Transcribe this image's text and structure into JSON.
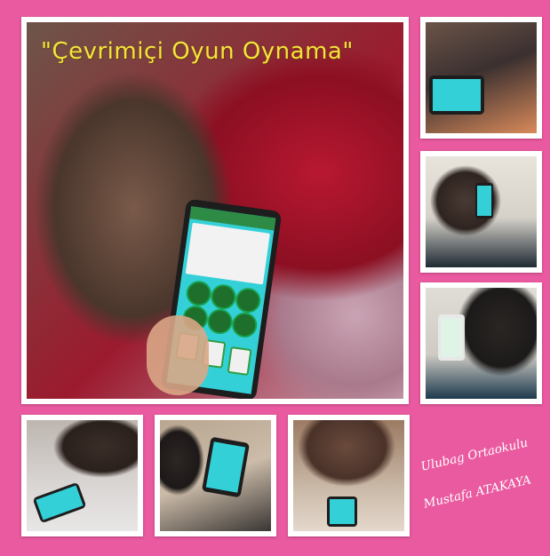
{
  "title": "\"Çevrimiçi Oyun Oynama\"",
  "caption": {
    "line1": "Ulubag Ortaokulu",
    "line2": "Mustafa ATAKAYA"
  },
  "colors": {
    "background": "#ea5aa0",
    "frame": "#ffffff",
    "title_text": "#f3e43a",
    "game_screen": "#34d0d8",
    "game_dots": "#1e6e2c"
  }
}
